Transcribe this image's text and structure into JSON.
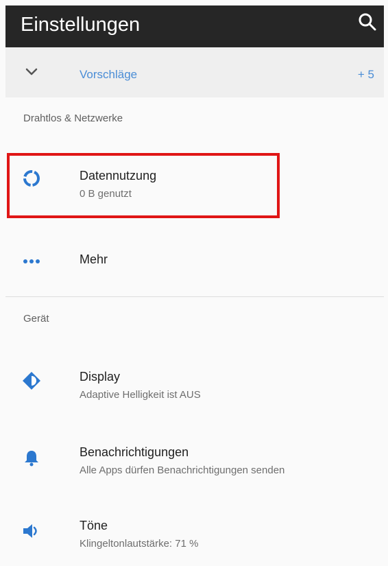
{
  "topbar": {
    "title": "Einstellungen",
    "search_icon": "search-icon"
  },
  "suggestions": {
    "label": "Vorschläge",
    "count": "+ 5",
    "icon": "chevron-down-icon"
  },
  "sections": {
    "wireless": "Drahtlos & Netzwerke",
    "device": "Gerät"
  },
  "items": {
    "data_usage": {
      "title": "Datennutzung",
      "subtitle": "0 B genutzt",
      "icon": "data-usage-icon"
    },
    "more": {
      "title": "Mehr",
      "icon": "more-icon"
    },
    "display": {
      "title": "Display",
      "subtitle": "Adaptive Helligkeit ist AUS",
      "icon": "brightness-icon"
    },
    "notifications": {
      "title": "Benachrichtigungen",
      "subtitle": "Alle Apps dürfen Benachrichtigungen senden",
      "icon": "bell-icon"
    },
    "sounds": {
      "title": "Töne",
      "subtitle": "Klingeltonlautstärke: 71 %",
      "icon": "volume-icon"
    }
  },
  "colors": {
    "accent": "#4a8dd6",
    "topbar": "#262626",
    "highlight": "#e01616",
    "background": "#fafafa"
  }
}
